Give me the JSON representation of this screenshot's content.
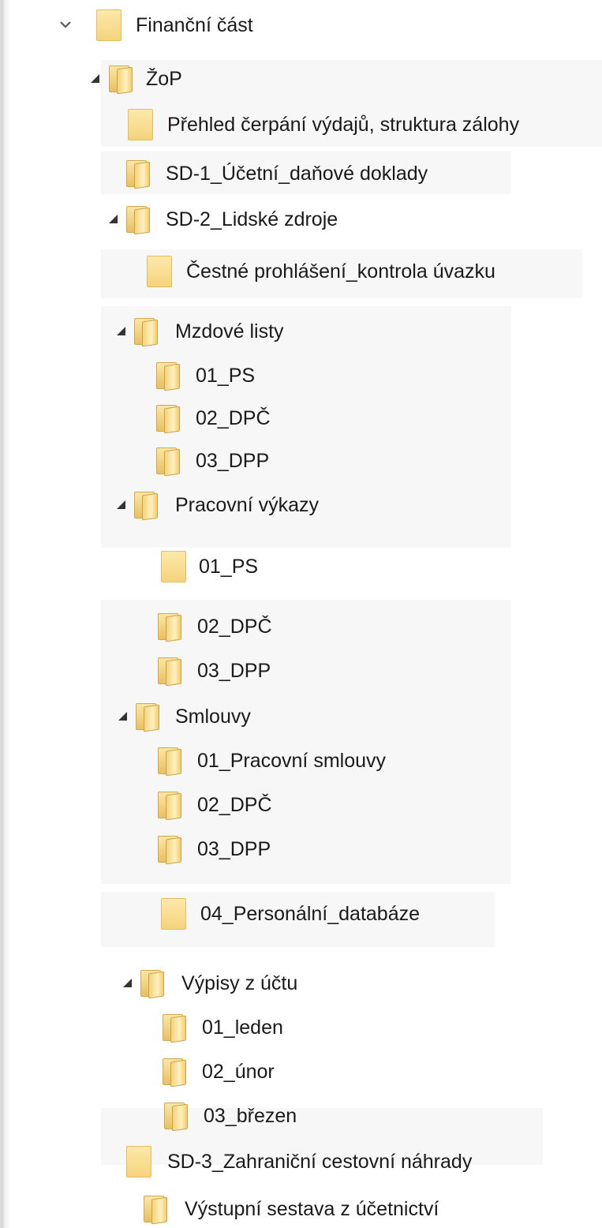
{
  "tree": {
    "root": {
      "label": "Finanční část",
      "icon": "folder-icon",
      "expanded": true
    },
    "items": [
      {
        "label": "ŽoP",
        "icon": "folder-open-icon",
        "expanded": true
      },
      {
        "label": "Přehled čerpání výdajů, struktura zálohy",
        "icon": "folder-icon"
      },
      {
        "label": "SD-1_Účetní_daňové doklady",
        "icon": "folder-open-icon"
      },
      {
        "label": "SD-2_Lidské zdroje",
        "icon": "folder-open-icon",
        "expanded": true
      },
      {
        "label": "Čestné prohlášení_kontrola úvazku",
        "icon": "folder-icon"
      },
      {
        "label": "Mzdové listy",
        "icon": "folder-open-icon",
        "expanded": true
      },
      {
        "label": "01_PS",
        "icon": "folder-open-icon"
      },
      {
        "label": "02_DPČ",
        "icon": "folder-open-icon"
      },
      {
        "label": "03_DPP",
        "icon": "folder-open-icon"
      },
      {
        "label": "Pracovní výkazy",
        "icon": "folder-open-icon",
        "expanded": true
      },
      {
        "label": "01_PS",
        "icon": "folder-icon"
      },
      {
        "label": "02_DPČ",
        "icon": "folder-open-icon"
      },
      {
        "label": "03_DPP",
        "icon": "folder-open-icon"
      },
      {
        "label": "Smlouvy",
        "icon": "folder-open-icon",
        "expanded": true
      },
      {
        "label": "01_Pracovní smlouvy",
        "icon": "folder-open-icon"
      },
      {
        "label": "02_DPČ",
        "icon": "folder-open-icon"
      },
      {
        "label": "03_DPP",
        "icon": "folder-open-icon"
      },
      {
        "label": "04_Personální_databáze",
        "icon": "folder-icon"
      },
      {
        "label": "Výpisy z účtu",
        "icon": "folder-open-icon",
        "expanded": true
      },
      {
        "label": "01_leden",
        "icon": "folder-open-icon"
      },
      {
        "label": "02_únor",
        "icon": "folder-open-icon"
      },
      {
        "label": "03_březen",
        "icon": "folder-open-icon"
      },
      {
        "label": "SD-3_Zahraniční cestovní náhrady",
        "icon": "folder-icon"
      },
      {
        "label": "Výstupní sestava z účetnictví",
        "icon": "folder-open-icon"
      }
    ]
  }
}
